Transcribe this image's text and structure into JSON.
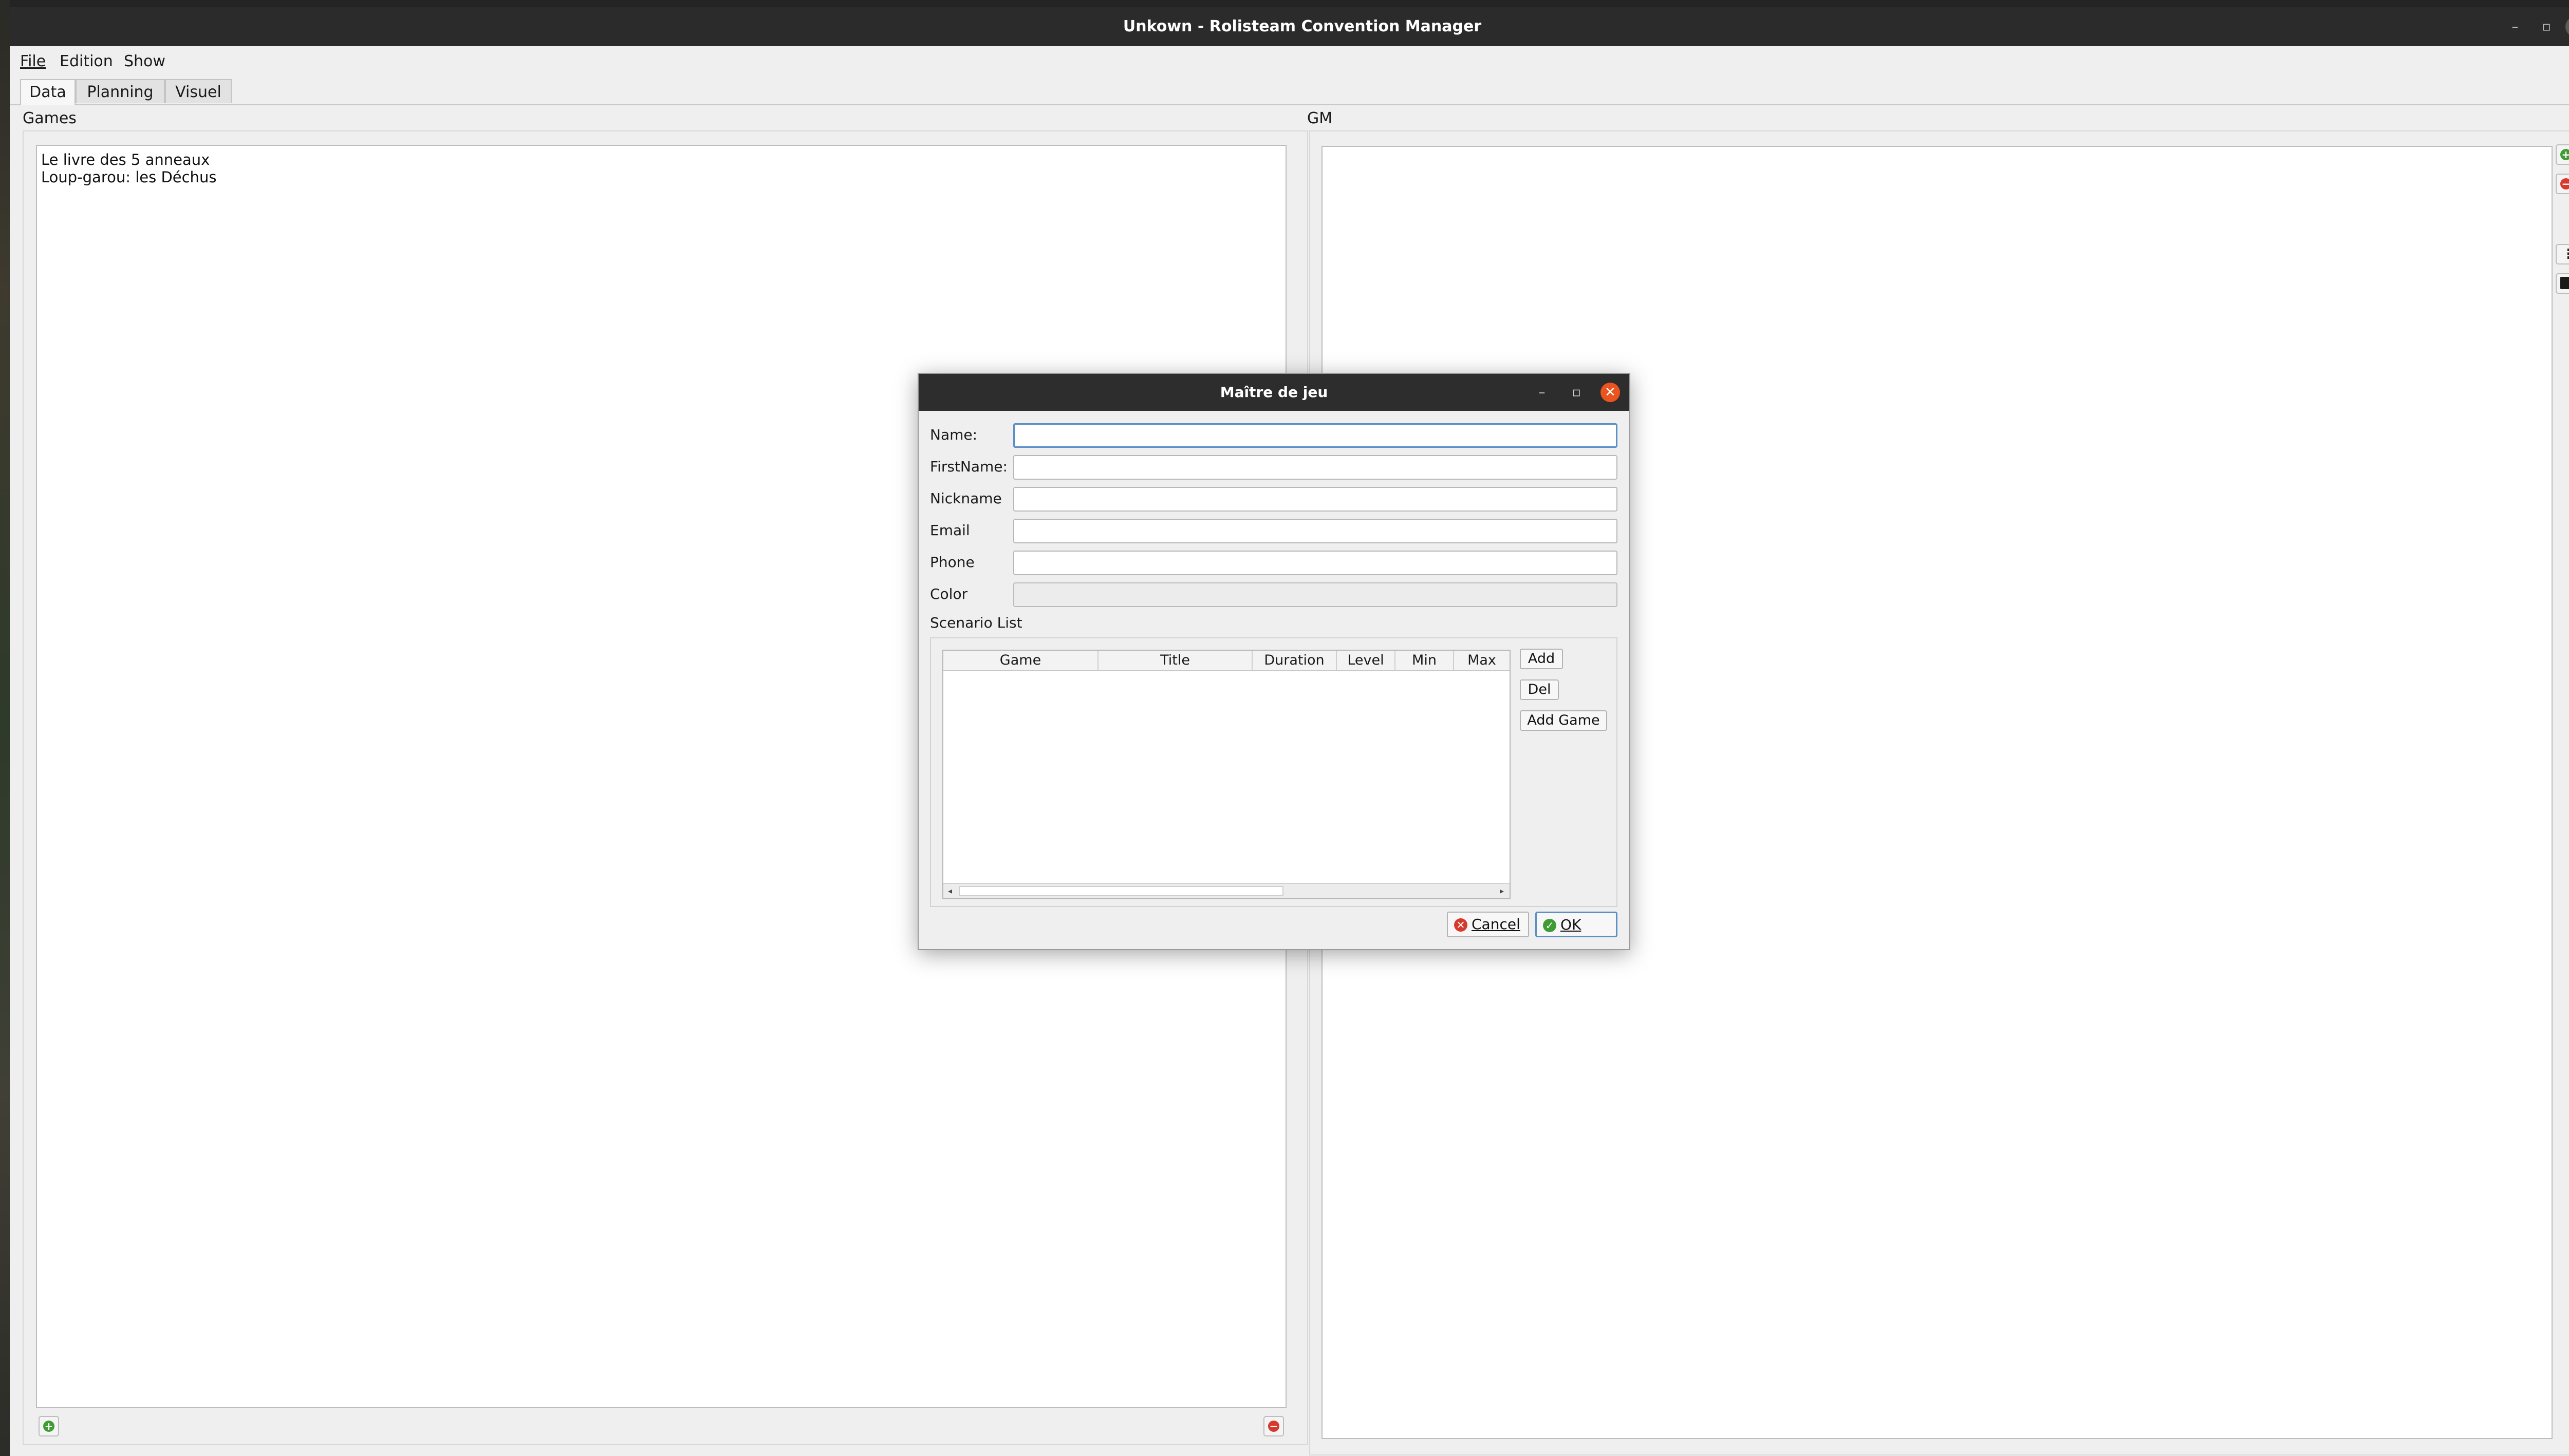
{
  "window": {
    "title": "Unkown - Rolisteam Convention Manager"
  },
  "menu": [
    "File",
    "Edition",
    "Show"
  ],
  "tabs": [
    "Data",
    "Planning",
    "Visuel"
  ],
  "games_panel": {
    "title": "Games",
    "items": [
      "Le livre des 5 anneaux",
      "Loup-garou: les Déchus"
    ]
  },
  "gm_panel": {
    "title": "GM"
  },
  "dialog": {
    "title": "Maître de jeu",
    "fields": {
      "name": {
        "label": "Name:",
        "value": ""
      },
      "firstname": {
        "label": "FirstName:",
        "value": ""
      },
      "nickname": {
        "label": "Nickname",
        "value": ""
      },
      "email": {
        "label": "Email",
        "value": ""
      },
      "phone": {
        "label": "Phone",
        "value": ""
      },
      "color": {
        "label": "Color"
      }
    },
    "scenario_list": {
      "label": "Scenario List",
      "columns": [
        "Game",
        "Title",
        "Duration",
        "Level",
        "Min",
        "Max"
      ],
      "rows": []
    },
    "buttons": {
      "add": "Add",
      "del": "Del",
      "add_game": "Add Game",
      "cancel": "Cancel",
      "ok": "OK"
    }
  },
  "colors": {
    "accent": "#5b8fc6",
    "add": "#3f9c35",
    "remove": "#d63a2c",
    "close": "#e9541f"
  }
}
